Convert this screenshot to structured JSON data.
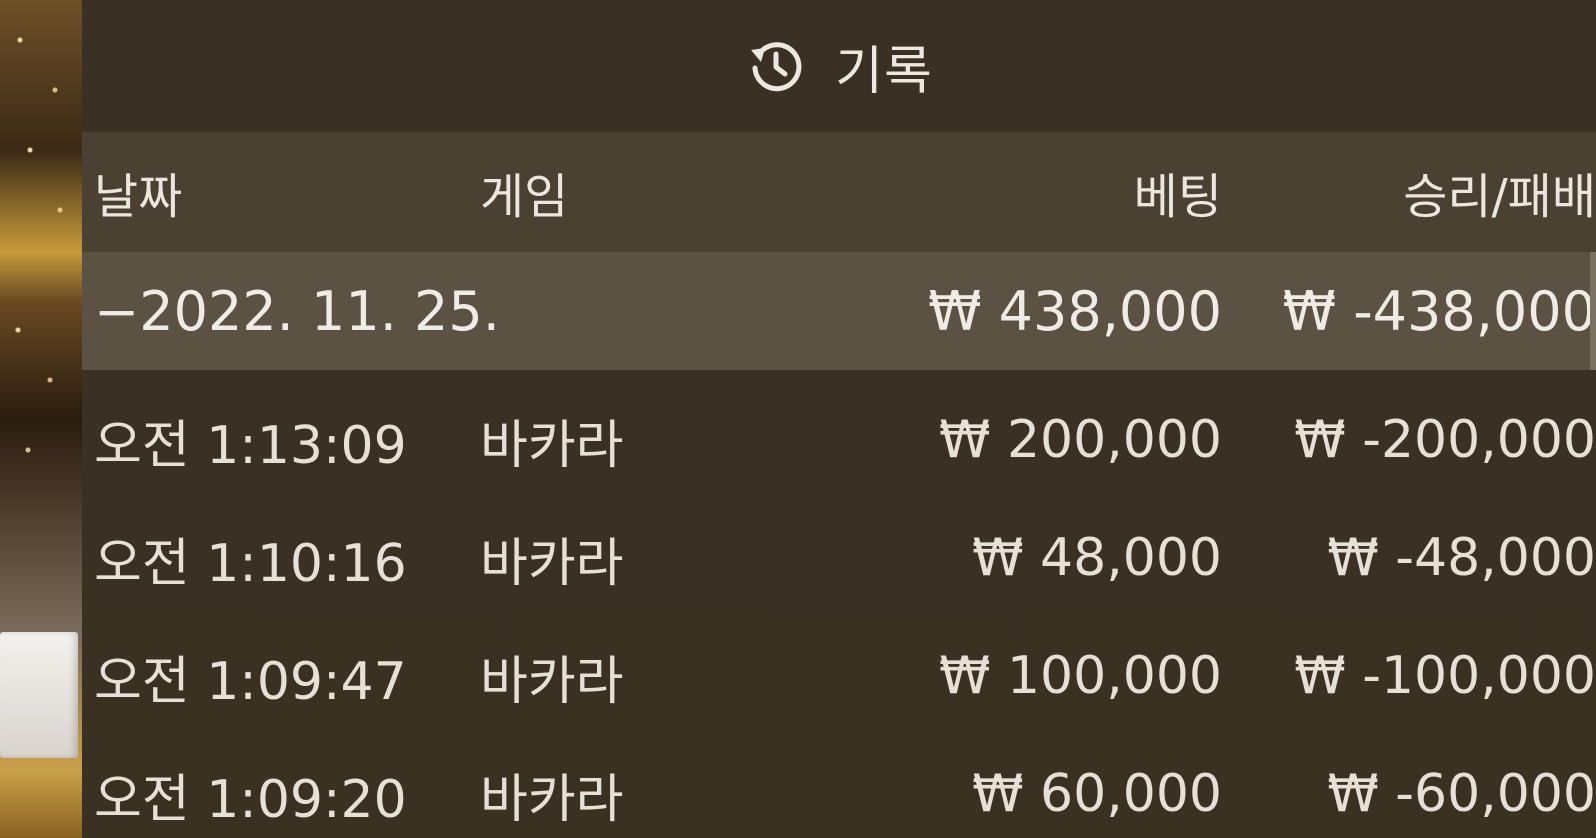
{
  "header": {
    "title": "기록",
    "icon": "history-icon"
  },
  "table": {
    "columns": {
      "date": "날짜",
      "game": "게임",
      "bet": "베팅",
      "win_loss": "승리/패배"
    },
    "summary": {
      "date": "−2022. 11. 25.",
      "bet": "₩ 438,000",
      "win_loss": "₩ -438,000"
    },
    "rows": [
      {
        "time": "오전 1:13:09",
        "game": "바카라",
        "bet": "₩ 200,000",
        "win_loss": "₩ -200,000"
      },
      {
        "time": "오전 1:10:16",
        "game": "바카라",
        "bet": "₩ 48,000",
        "win_loss": "₩ -48,000"
      },
      {
        "time": "오전 1:09:47",
        "game": "바카라",
        "bet": "₩ 100,000",
        "win_loss": "₩ -100,000"
      },
      {
        "time": "오전 1:09:20",
        "game": "바카라",
        "bet": "₩ 60,000",
        "win_loss": "₩ -60,000"
      }
    ]
  },
  "colors": {
    "panel": "#3a3124",
    "header_row": "#4b4133",
    "summary_row": "#5b5244",
    "text": "#e9e4dc"
  }
}
